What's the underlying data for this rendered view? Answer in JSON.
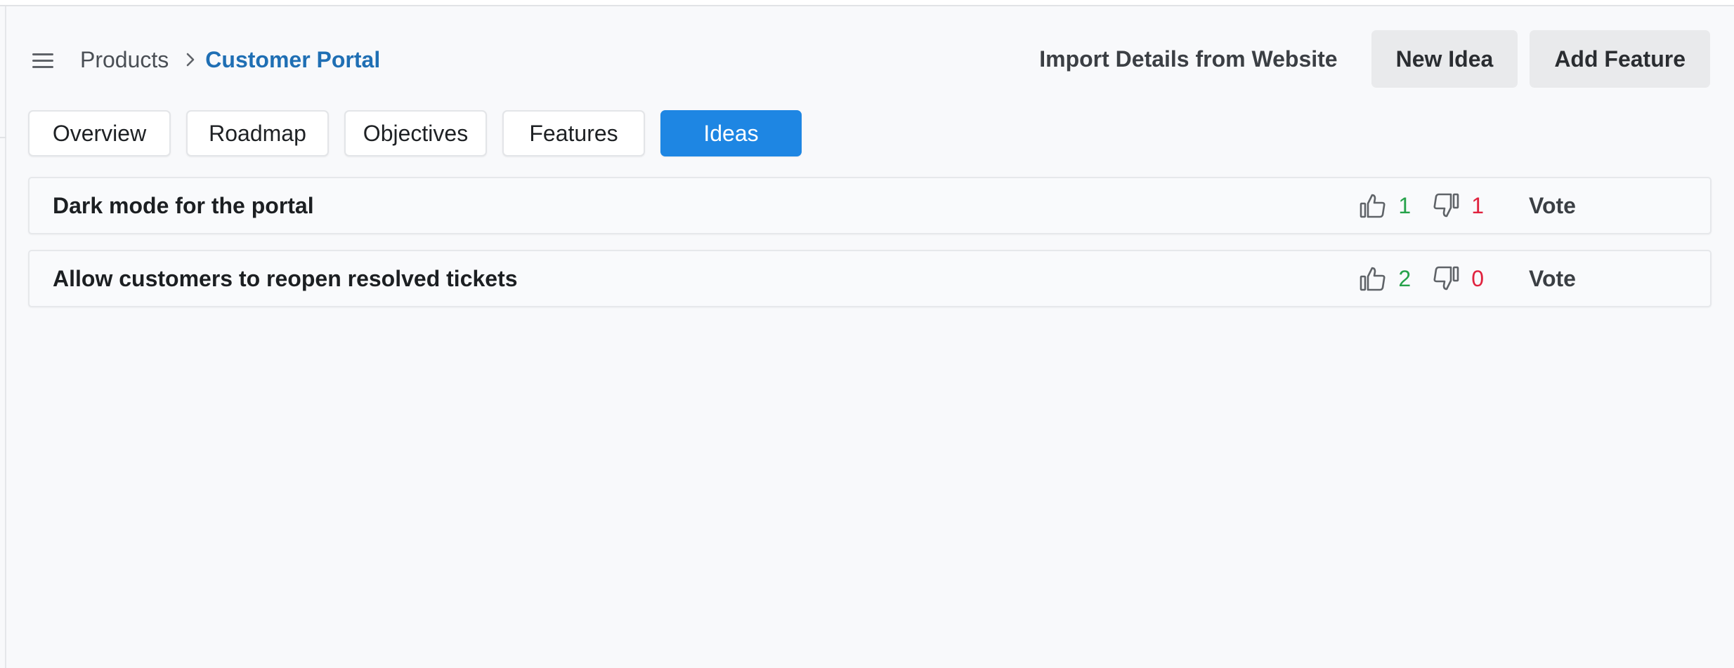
{
  "header": {
    "menu_icon": "hamburger-menu-icon",
    "breadcrumb": {
      "parent": "Products",
      "separator_icon": "chevron-right-icon",
      "current": "Customer Portal"
    },
    "actions": {
      "import_label": "Import Details from Website",
      "new_idea_label": "New Idea",
      "add_feature_label": "Add Feature"
    }
  },
  "tabs": [
    {
      "label": "Overview",
      "active": false
    },
    {
      "label": "Roadmap",
      "active": false
    },
    {
      "label": "Objectives",
      "active": false
    },
    {
      "label": "Features",
      "active": false
    },
    {
      "label": "Ideas",
      "active": true
    }
  ],
  "ideas": [
    {
      "title": "Dark mode for the portal",
      "upvotes": "1",
      "downvotes": "1",
      "vote_label": "Vote"
    },
    {
      "title": "Allow customers to reopen resolved tickets",
      "upvotes": "2",
      "downvotes": "0",
      "vote_label": "Vote"
    }
  ],
  "icons": {
    "upvote": "thumbs-up-icon",
    "downvote": "thumbs-down-icon"
  },
  "colors": {
    "accent": "#1e86e3",
    "breadcrumb_current": "#1f6fb4",
    "upvote_count": "#26a24a",
    "downvote_count": "#e0223e"
  }
}
